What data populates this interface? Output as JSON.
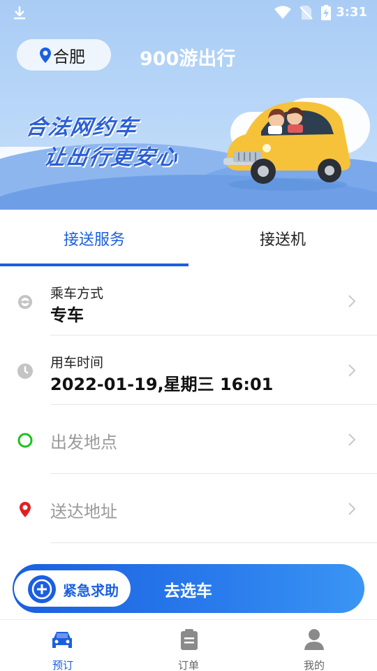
{
  "status_bar": {
    "time": "3:31"
  },
  "header": {
    "city": "合肥",
    "app_title": "900游出行"
  },
  "banner": {
    "slogan_line1": "合法网约车",
    "slogan_line2": "让出行更安心"
  },
  "tabs": [
    {
      "label": "接送服务",
      "selected": true
    },
    {
      "label": "接送机",
      "selected": false
    }
  ],
  "form": {
    "ride_type": {
      "label": "乘车方式",
      "value": "专车"
    },
    "ride_time": {
      "label": "用车时间",
      "value": "2022-01-19,星期三 16:01"
    },
    "departure": {
      "placeholder": "出发地点"
    },
    "destination": {
      "placeholder": "送达地址"
    }
  },
  "actions": {
    "emergency_label": "紧急求助",
    "choose_car_label": "去选车"
  },
  "bottom_nav": [
    {
      "label": "预订",
      "icon": "car-icon",
      "active": true
    },
    {
      "label": "订单",
      "icon": "clipboard-icon",
      "active": false
    },
    {
      "label": "我的",
      "icon": "person-icon",
      "active": false
    }
  ],
  "colors": {
    "primary": "#1b5fe0",
    "start_point": "#1cc21c",
    "end_point": "#e02020"
  }
}
